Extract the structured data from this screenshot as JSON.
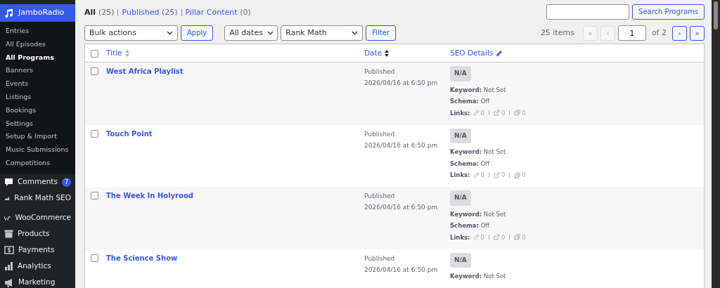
{
  "sidebar": {
    "current": {
      "label": "JamboRadio"
    },
    "submenu": [
      {
        "label": "Entries",
        "selected": false
      },
      {
        "label": "All Episodes",
        "selected": false
      },
      {
        "label": "All Programs",
        "selected": true
      },
      {
        "label": "Banners",
        "selected": false
      },
      {
        "label": "Events",
        "selected": false
      },
      {
        "label": "Listings",
        "selected": false
      },
      {
        "label": "Bookings",
        "selected": false
      },
      {
        "label": "Settings",
        "selected": false
      },
      {
        "label": "Setup & Import",
        "selected": false
      },
      {
        "label": "Music Submissions",
        "selected": false
      },
      {
        "label": "Competitions",
        "selected": false
      }
    ],
    "items": [
      {
        "label": "Comments",
        "badge": "7"
      },
      {
        "label": "Rank Math SEO"
      },
      {
        "label": "WooCommerce"
      },
      {
        "label": "Products"
      },
      {
        "label": "Payments"
      },
      {
        "label": "Analytics"
      },
      {
        "label": "Marketing"
      }
    ]
  },
  "views": [
    {
      "label": "All",
      "count": "(25)",
      "selected": true
    },
    {
      "label": "Published",
      "count": "(25)",
      "selected": false
    },
    {
      "label": "Pillar Content",
      "count": "(0)",
      "selected": false
    }
  ],
  "search": {
    "button": "Search Programs"
  },
  "toolbar": {
    "bulk": "Bulk actions",
    "apply": "Apply",
    "dates": "All dates",
    "seo_filter": "Rank Math",
    "filter": "Filter"
  },
  "pagination": {
    "items": "25 items",
    "first": "«",
    "prev": "‹",
    "page": "1",
    "of": "of 2",
    "next": "›",
    "last": "»"
  },
  "table": {
    "columns": [
      "Title",
      "Date",
      "SEO Details"
    ],
    "select_all_checked": false,
    "rows": [
      {
        "checked": false,
        "title": "West Africa Playlist",
        "status": "Published",
        "date": "2026/04/16 at 6:50 pm",
        "score": "N/A",
        "keyword_label": "Keyword:",
        "keyword": "Not Set",
        "schema_label": "Schema:",
        "schema": "Off",
        "links_label": "Links:",
        "links": [
          "0",
          "0",
          "0"
        ]
      },
      {
        "checked": false,
        "title": "Touch Point",
        "status": "Published",
        "date": "2026/04/16 at 6:50 pm",
        "score": "N/A",
        "keyword_label": "Keyword:",
        "keyword": "Not Set",
        "schema_label": "Schema:",
        "schema": "Off",
        "links_label": "Links:",
        "links": [
          "0",
          "0",
          "0"
        ]
      },
      {
        "checked": false,
        "title": "The Week In Holyrood",
        "status": "Published",
        "date": "2026/04/16 at 6:50 pm",
        "score": "N/A",
        "keyword_label": "Keyword:",
        "keyword": "Not Set",
        "schema_label": "Schema:",
        "schema": "Off",
        "links_label": "Links:",
        "links": [
          "0",
          "0",
          "0"
        ]
      },
      {
        "checked": false,
        "title": "The Science Show",
        "status": "Published",
        "date": "2026/04/16 at 6:50 pm",
        "score": "N/A",
        "keyword_label": "Keyword:",
        "keyword": "Not Set"
      }
    ]
  }
}
